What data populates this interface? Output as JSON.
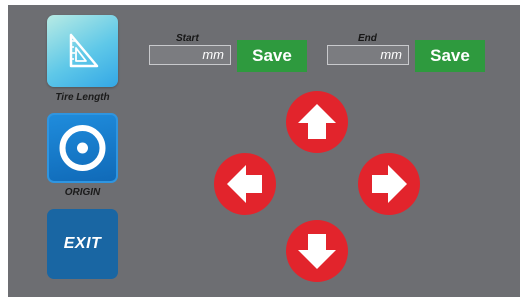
{
  "sidebar": {
    "tire_length": {
      "label": "Tire Length",
      "icon": "ruler-triangle-icon"
    },
    "origin": {
      "label": "ORIGIN",
      "icon": "target-icon"
    },
    "exit": {
      "label": "EXIT"
    }
  },
  "start": {
    "label": "Start",
    "unit": "mm",
    "value": "",
    "save_label": "Save"
  },
  "end": {
    "label": "End",
    "unit": "mm",
    "value": "",
    "save_label": "Save"
  },
  "dpad": {
    "up": "arrow-up-icon",
    "left": "arrow-left-icon",
    "right": "arrow-right-icon",
    "down": "arrow-down-icon"
  },
  "colors": {
    "panel_bg": "#6d6e72",
    "save_green": "#2e9a3e",
    "dpad_red": "#e2242c",
    "exit_blue": "#1966a3",
    "origin_blue": "#106ab8"
  }
}
